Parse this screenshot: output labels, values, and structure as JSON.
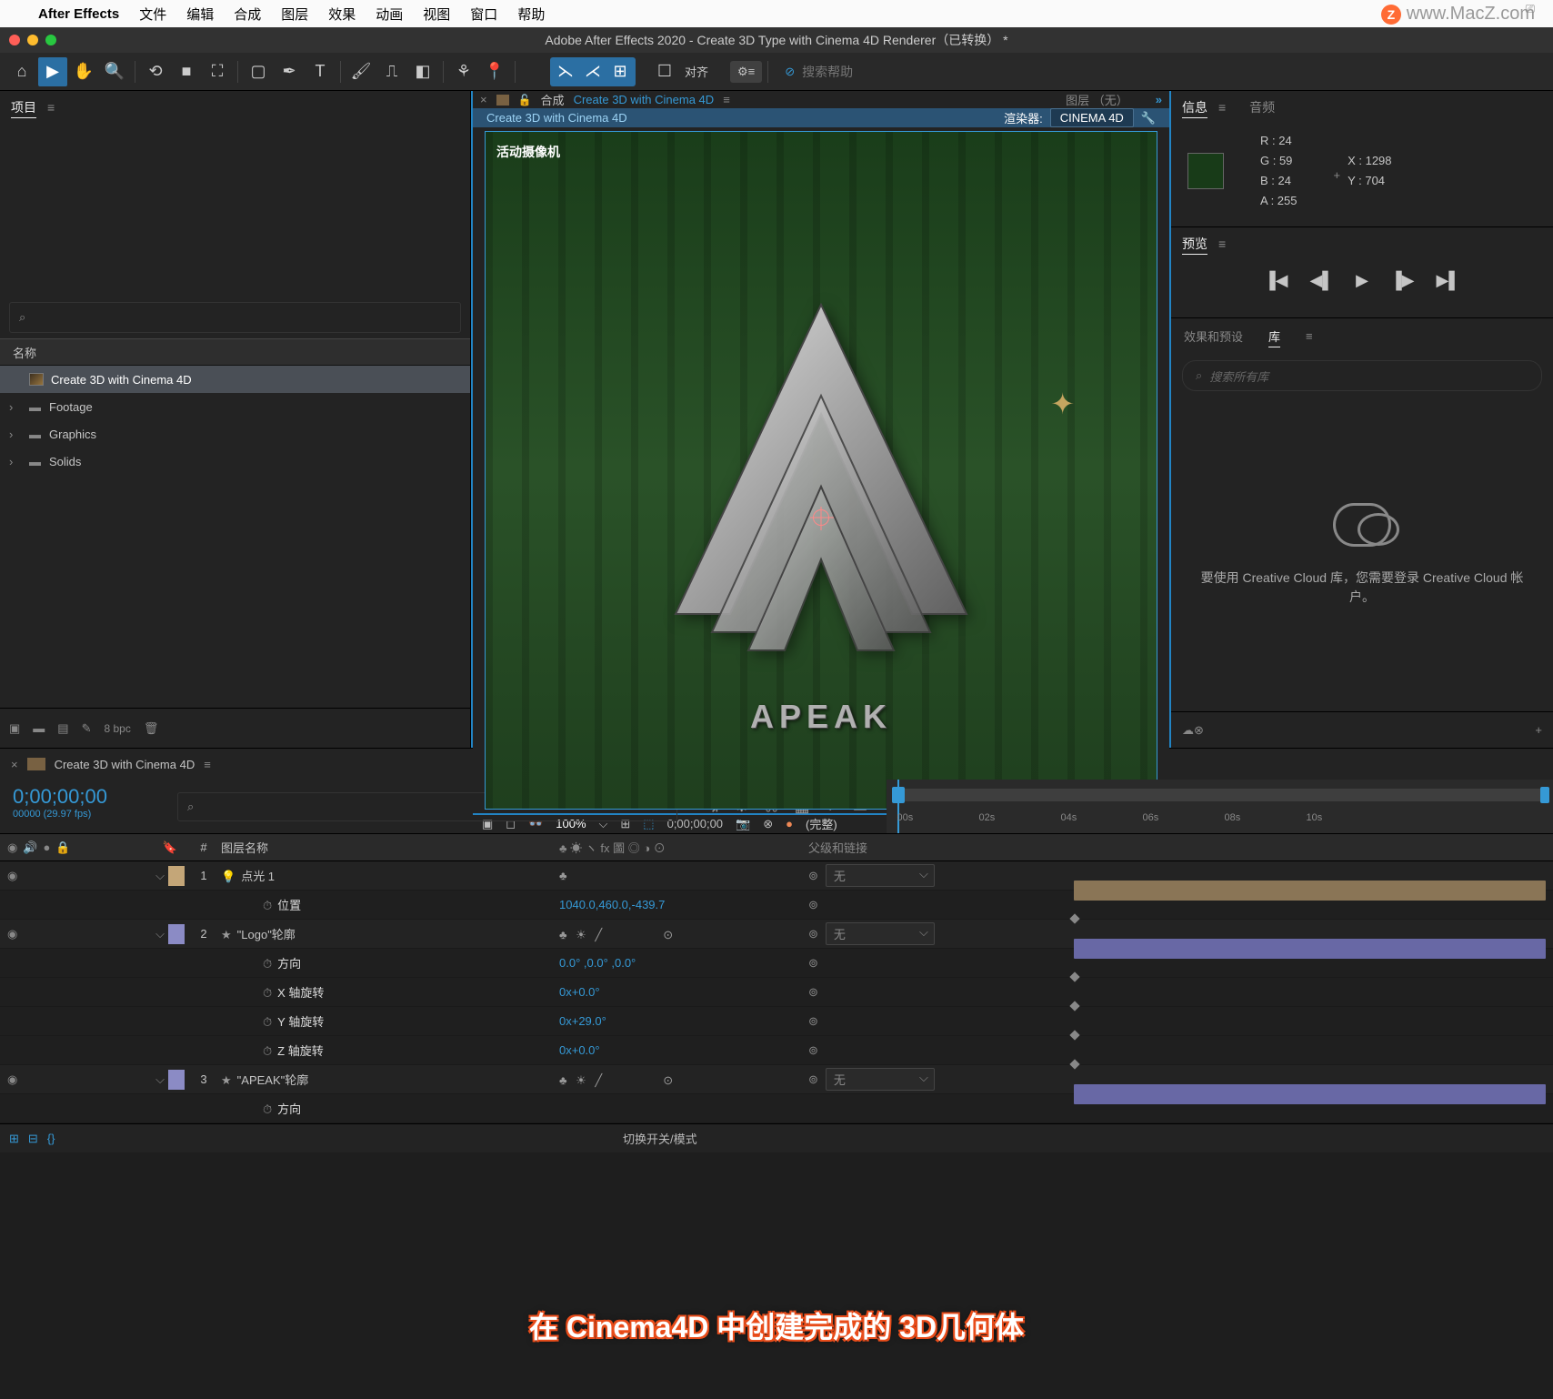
{
  "menubar": {
    "app": "After Effects",
    "items": [
      "文件",
      "编辑",
      "合成",
      "图层",
      "效果",
      "动画",
      "视图",
      "窗口",
      "帮助"
    ]
  },
  "watermark": "www.MacZ.com",
  "window_title": "Adobe After Effects 2020 - Create 3D Type with Cinema 4D Renderer（已转换） *",
  "toolbar": {
    "align": "对齐",
    "search_ph": "搜索帮助"
  },
  "project": {
    "tab": "项目",
    "search": "",
    "header": "名称",
    "items": [
      {
        "name": "Create 3D with Cinema 4D",
        "type": "comp",
        "sel": true
      },
      {
        "name": "Footage",
        "type": "folder"
      },
      {
        "name": "Graphics",
        "type": "folder"
      },
      {
        "name": "Solids",
        "type": "folder"
      }
    ],
    "bpc": "8 bpc"
  },
  "comp_panel": {
    "tab_label": "合成",
    "tab_name": "Create 3D with Cinema 4D",
    "layer_tab": "图层 （无）",
    "renderer_label": "渲染器:",
    "renderer": "CINEMA 4D",
    "comp_name": "Create 3D with Cinema 4D",
    "camera": "活动摄像机",
    "apeak": "APEAK",
    "zoom": "100%",
    "timecode": "0;00;00;00",
    "full": "(完整)"
  },
  "info": {
    "tab": "信息",
    "audio_tab": "音频",
    "r": "R :  24",
    "g": "G :  59",
    "b": "B :  24",
    "a": "A :  255",
    "x": "X : 1298",
    "y": "Y :  704"
  },
  "preview": {
    "tab": "预览"
  },
  "libraries": {
    "tab_presets": "效果和预设",
    "tab_lib": "库",
    "search_ph": "搜索所有库",
    "msg": "要使用 Creative Cloud 库，您需要登录 Creative Cloud 帐户。"
  },
  "timeline": {
    "tab": "Create 3D with Cinema 4D",
    "cur_time": "0;00;00;00",
    "fps": "00000 (29.97 fps)",
    "ruler": [
      "00s",
      "02s",
      "04s",
      "06s",
      "08s",
      "10s"
    ],
    "hdr": {
      "num": "#",
      "name": "图层名称",
      "switches": "♣ ☀ ヽ fx 圖 ◎ ◑ ⊙",
      "parent": "父级和链接"
    },
    "none": "无",
    "layers": [
      {
        "num": "1",
        "name": "点光 1",
        "color": "tan",
        "icon": "bulb",
        "parent": "无",
        "props": [
          {
            "name": "位置",
            "val": "1040.0,460.0,-439.7"
          }
        ]
      },
      {
        "num": "2",
        "name": "\"Logo\"轮廓",
        "color": "purple",
        "icon": "star",
        "parent": "无",
        "props": [
          {
            "name": "方向",
            "val": "0.0°  ,0.0°  ,0.0°"
          },
          {
            "name": "X 轴旋转",
            "val": "0x+0.0°"
          },
          {
            "name": "Y 轴旋转",
            "val": "0x+29.0°"
          },
          {
            "name": "Z 轴旋转",
            "val": "0x+0.0°"
          }
        ]
      },
      {
        "num": "3",
        "name": "\"APEAK\"轮廓",
        "color": "purple",
        "icon": "star",
        "parent": "无",
        "props": [
          {
            "name": "方向",
            "val": ""
          }
        ]
      }
    ],
    "footer_switch": "切换开关/模式"
  },
  "caption": {
    "pre": "在 ",
    "hl1": "Cinema4D ",
    "mid": "中创建完成的 ",
    "hl2": "3D几何体"
  }
}
